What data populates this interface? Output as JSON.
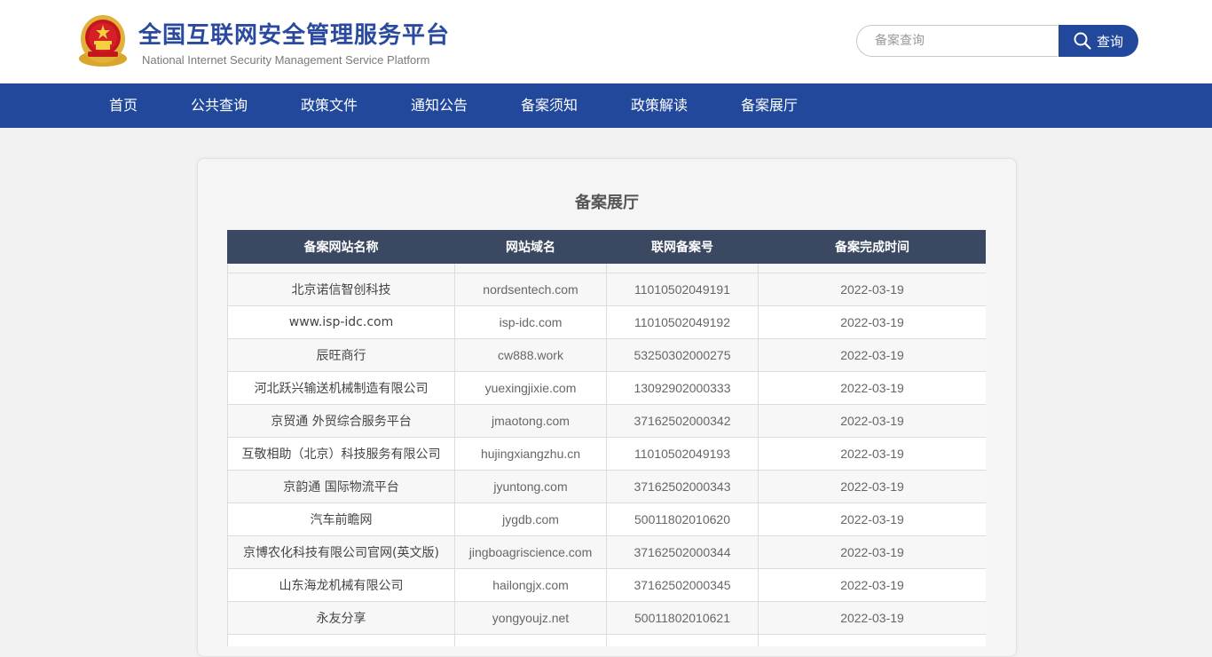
{
  "header": {
    "title": "全国互联网安全管理服务平台",
    "subtitle": "National Internet Security Management Service Platform",
    "logo_icon": "national-emblem-icon"
  },
  "search": {
    "placeholder": "备案查询",
    "button_label": "查询",
    "icon": "search-icon"
  },
  "nav": {
    "items": [
      {
        "label": "首页"
      },
      {
        "label": "公共查询"
      },
      {
        "label": "政策文件"
      },
      {
        "label": "通知公告"
      },
      {
        "label": "备案须知"
      },
      {
        "label": "政策解读"
      },
      {
        "label": "备案展厅"
      }
    ]
  },
  "main": {
    "title": "备案展厅",
    "table": {
      "headers": [
        "备案网站名称",
        "网站域名",
        "联网备案号",
        "备案完成时间"
      ],
      "rows": [
        {
          "name": "北京诺信智创科技",
          "domain": "nordsentech.com",
          "record": "11010502049191",
          "date": "2022-03-19"
        },
        {
          "name": "www.isp-idc.com",
          "domain": "isp-idc.com",
          "record": "11010502049192",
          "date": "2022-03-19"
        },
        {
          "name": "辰旺商行",
          "domain": "cw888.work",
          "record": "53250302000275",
          "date": "2022-03-19"
        },
        {
          "name": "河北跃兴输送机械制造有限公司",
          "domain": "yuexingjixie.com",
          "record": "13092902000333",
          "date": "2022-03-19"
        },
        {
          "name": "京贸通 外贸综合服务平台",
          "domain": "jmaotong.com",
          "record": "37162502000342",
          "date": "2022-03-19"
        },
        {
          "name": "互敬相助（北京）科技服务有限公司",
          "domain": "hujingxiangzhu.cn",
          "record": "11010502049193",
          "date": "2022-03-19"
        },
        {
          "name": "京韵通 国际物流平台",
          "domain": "jyuntong.com",
          "record": "37162502000343",
          "date": "2022-03-19"
        },
        {
          "name": "汽车前瞻网",
          "domain": "jygdb.com",
          "record": "50011802010620",
          "date": "2022-03-19"
        },
        {
          "name": "京博农化科技有限公司官网(英文版)",
          "domain": "jingboagriscience.com",
          "record": "37162502000344",
          "date": "2022-03-19"
        },
        {
          "name": "山东海龙机械有限公司",
          "domain": "hailongjx.com",
          "record": "37162502000345",
          "date": "2022-03-19"
        },
        {
          "name": "永友分享",
          "domain": "yongyoujz.net",
          "record": "50011802010621",
          "date": "2022-03-19"
        }
      ]
    }
  }
}
